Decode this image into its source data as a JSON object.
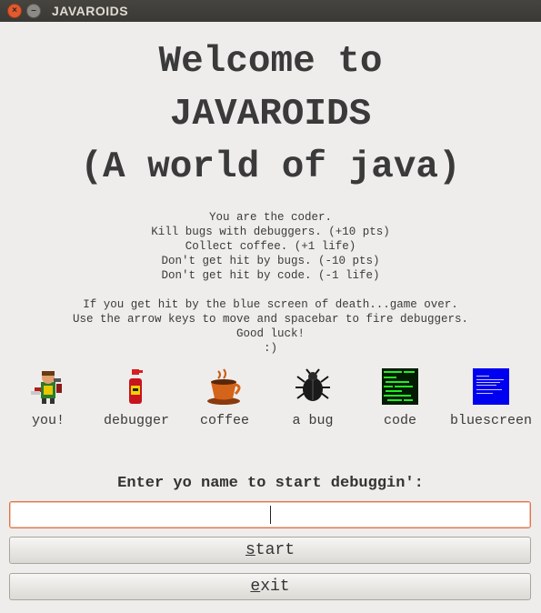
{
  "window": {
    "title": "JAVAROIDS",
    "close_glyph": "×",
    "minimize_glyph": "–"
  },
  "headline": {
    "line1": "Welcome to",
    "line2": "JAVAROIDS",
    "line3": "(A world of java)"
  },
  "instructions": {
    "block1": [
      "You are the coder.",
      "Kill bugs with debuggers. (+10 pts)",
      "Collect coffee. (+1 life)",
      "Don't get hit by bugs. (-10 pts)",
      "Don't get hit by code. (-1 life)"
    ],
    "block2": [
      "If you get hit by the blue screen of death...game over.",
      "Use the arrow keys to move and spacebar to fire debuggers.",
      "Good luck!",
      ":)"
    ]
  },
  "sprites": [
    {
      "label": "you!",
      "icon": "coder-character-icon"
    },
    {
      "label": "debugger",
      "icon": "spray-bottle-icon"
    },
    {
      "label": "coffee",
      "icon": "coffee-cup-icon"
    },
    {
      "label": "a bug",
      "icon": "beetle-icon"
    },
    {
      "label": "code",
      "icon": "code-screen-icon"
    },
    {
      "label": "bluescreen",
      "icon": "bluescreen-icon"
    }
  ],
  "form": {
    "prompt": "Enter yo name to start debuggin':",
    "name_value": "",
    "start_label": {
      "mnemonic": "s",
      "rest": "tart"
    },
    "exit_label": {
      "mnemonic": "e",
      "rest": "xit"
    }
  },
  "colors": {
    "titlebar": "#3f3e3a",
    "background": "#efedeb",
    "input_focus_border": "#e0744a",
    "bluescreen": "#0000ff",
    "code_green": "#00ff00"
  }
}
